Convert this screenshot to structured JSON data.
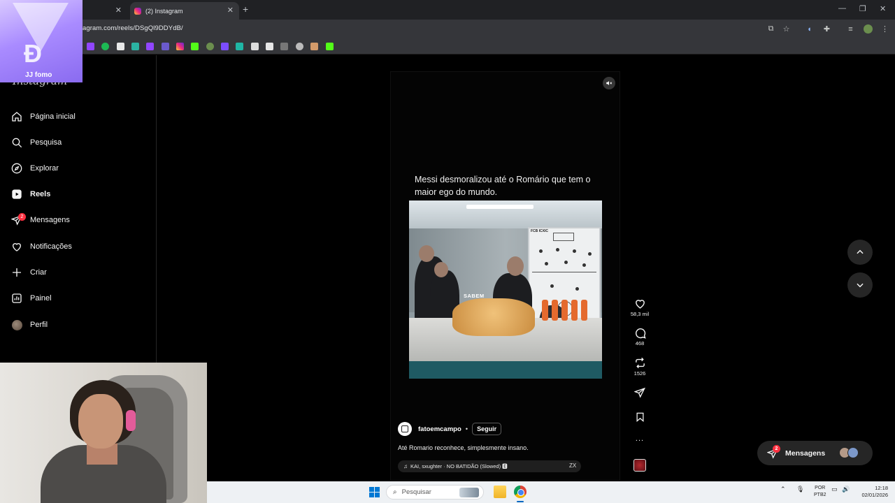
{
  "browser": {
    "tabs": [
      {
        "label": "",
        "active": false
      },
      {
        "label": "(2) Instagram",
        "active": true
      }
    ],
    "url": "agram.com/reels/DSgQl9DDYdB/"
  },
  "overlay": {
    "brand": "JJ fomo"
  },
  "sidebar": {
    "wordmark": "Instagram",
    "items": [
      {
        "label": "Página inicial",
        "icon": "home-icon"
      },
      {
        "label": "Pesquisa",
        "icon": "search-icon"
      },
      {
        "label": "Explorar",
        "icon": "compass-icon"
      },
      {
        "label": "Reels",
        "icon": "reels-icon",
        "active": true
      },
      {
        "label": "Mensagens",
        "icon": "messenger-icon",
        "badge": "2"
      },
      {
        "label": "Notificações",
        "icon": "heart-icon"
      },
      {
        "label": "Criar",
        "icon": "plus-icon"
      },
      {
        "label": "Painel",
        "icon": "dashboard-icon"
      },
      {
        "label": "Perfil",
        "icon": "avatar"
      }
    ]
  },
  "reel": {
    "caption_overlay": "Messi desmoralizou até o Romário que tem o maior ego do mundo.",
    "video_text": "SABEM",
    "board_tag": "FCB ICXIC",
    "author": "fatoemcampo",
    "separator": "•",
    "follow_label": "Seguir",
    "description": "Até Romario reconhece, simplesmente insano.",
    "audio": "KAI, sxughter · NO BATIDÃO (Slowed) 🅴",
    "audio_suffix": "ZX",
    "likes": "58,3 mil",
    "comments": "468",
    "reposts": "1526",
    "more": "..."
  },
  "messages_pill": {
    "label": "Mensagens",
    "badge": "2"
  },
  "taskbar": {
    "search_placeholder": "Pesquisar",
    "lang_top": "POR",
    "lang_bottom": "PTB2",
    "time": "12:18",
    "date": "02/01/2026"
  },
  "colors": {
    "badge": "#ff3040",
    "chrome_dark": "#202124",
    "chrome_toolbar": "#35363a",
    "ig_surface": "#262626"
  }
}
